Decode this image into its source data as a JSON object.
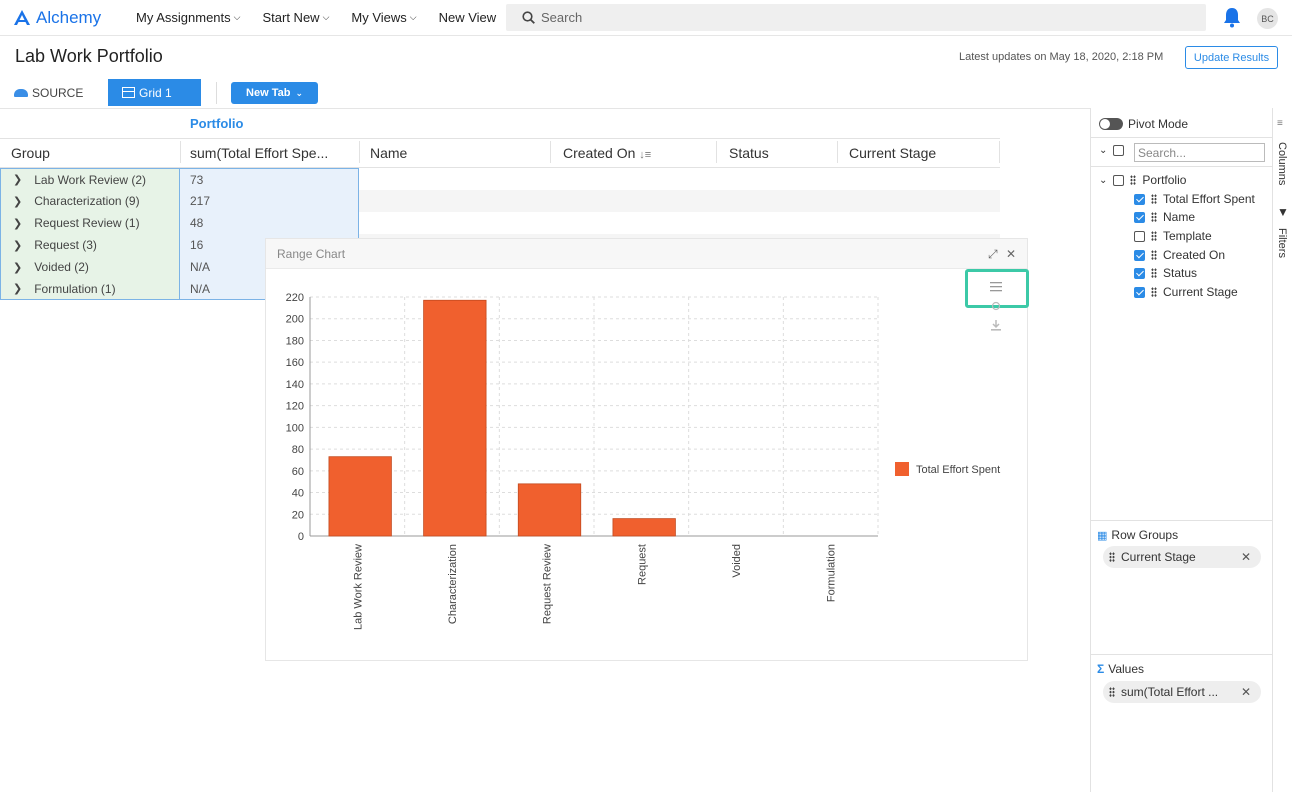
{
  "app": {
    "name": "Alchemy",
    "brand_color": "#1a73e8"
  },
  "nav": {
    "items": [
      {
        "label": "My Assignments",
        "has_menu": true
      },
      {
        "label": "Start New",
        "has_menu": true
      },
      {
        "label": "My Views",
        "has_menu": true
      },
      {
        "label": "New View",
        "has_menu": false
      }
    ],
    "search_placeholder": "Search",
    "avatar_initials": "BC"
  },
  "page": {
    "title": "Lab Work Portfolio",
    "updated_text": "Latest updates on May 18, 2020, 2:18 PM",
    "update_button": "Update Results"
  },
  "tabs": {
    "source_label": "SOURCE",
    "grid_label": "Grid 1",
    "new_tab_label": "New Tab"
  },
  "grid": {
    "group_header": "Portfolio",
    "columns": [
      "Group",
      "sum(Total Effort Spe...",
      "Name",
      "Created On",
      "Status",
      "Current Stage"
    ],
    "rows": [
      {
        "group": "Lab Work Review (2)",
        "value": "73"
      },
      {
        "group": "Characterization (9)",
        "value": "217"
      },
      {
        "group": "Request Review (1)",
        "value": "48"
      },
      {
        "group": "Request (3)",
        "value": "16"
      },
      {
        "group": "Voided (2)",
        "value": "N/A"
      },
      {
        "group": "Formulation (1)",
        "value": "N/A"
      }
    ]
  },
  "chart_panel": {
    "title": "Range Chart"
  },
  "chart_data": {
    "type": "bar",
    "title": "",
    "xlabel": "",
    "ylabel": "",
    "categories": [
      "Lab Work Review",
      "Characterization",
      "Request Review",
      "Request",
      "Voided",
      "Formulation"
    ],
    "series": [
      {
        "name": "Total Effort Spent",
        "values": [
          73,
          217,
          48,
          16,
          0,
          0
        ],
        "color": "#f0602e"
      }
    ],
    "ylim": [
      0,
      220
    ],
    "yticks": [
      0,
      20,
      40,
      60,
      80,
      100,
      120,
      140,
      160,
      180,
      200,
      220
    ],
    "grid": true,
    "legend_position": "right"
  },
  "side_panel": {
    "pivot_mode": "Pivot Mode",
    "search_placeholder": "Search...",
    "portfolio_label": "Portfolio",
    "columns": [
      {
        "label": "Total Effort Spent",
        "checked": true
      },
      {
        "label": "Name",
        "checked": true
      },
      {
        "label": "Template",
        "checked": false
      },
      {
        "label": "Created On",
        "checked": true
      },
      {
        "label": "Status",
        "checked": true
      },
      {
        "label": "Current Stage",
        "checked": true
      }
    ],
    "row_groups_title": "Row Groups",
    "row_group_chip": "Current Stage",
    "values_title": "Values",
    "values_chip": "sum(Total Effort ...",
    "strip_columns": "Columns",
    "strip_filters": "Filters"
  }
}
